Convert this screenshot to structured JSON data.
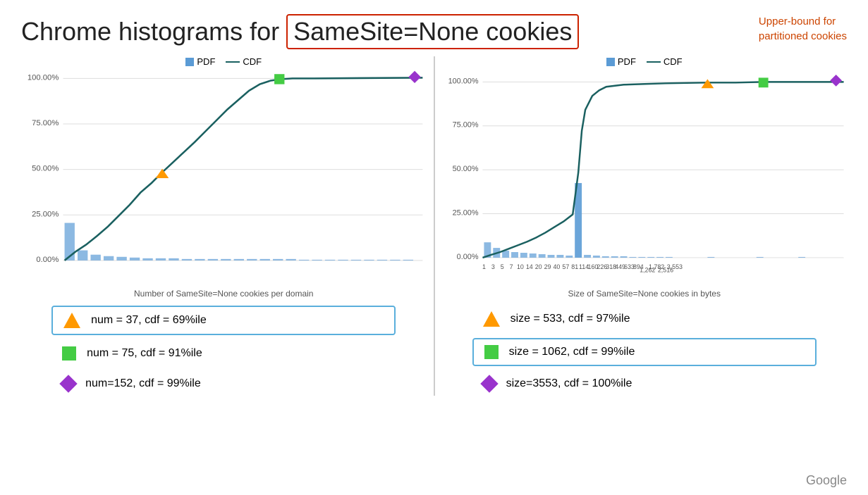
{
  "header": {
    "title_prefix": "Chrome histograms for",
    "title_highlight": "SameSite=None cookies",
    "note_line1": "Upper-bound for",
    "note_line2": "partitioned cookies"
  },
  "charts": {
    "left": {
      "legend": {
        "pdf": "PDF",
        "cdf": "CDF"
      },
      "subtitle": "Number of SameSite=None cookies per domain",
      "data": {
        "row1": "num = 37, cdf = 69%ile",
        "row2": "num = 75, cdf = 91%ile",
        "row3": "num=152, cdf = 99%ile"
      }
    },
    "right": {
      "legend": {
        "pdf": "PDF",
        "cdf": "CDF"
      },
      "subtitle": "Size of SameSite=None cookies in bytes",
      "data": {
        "row1": "size = 533, cdf = 97%ile",
        "row2": "size = 1062, cdf = 99%ile",
        "row3": "size=3553, cdf = 100%ile"
      }
    }
  },
  "footer": {
    "google_logo": "Google"
  }
}
